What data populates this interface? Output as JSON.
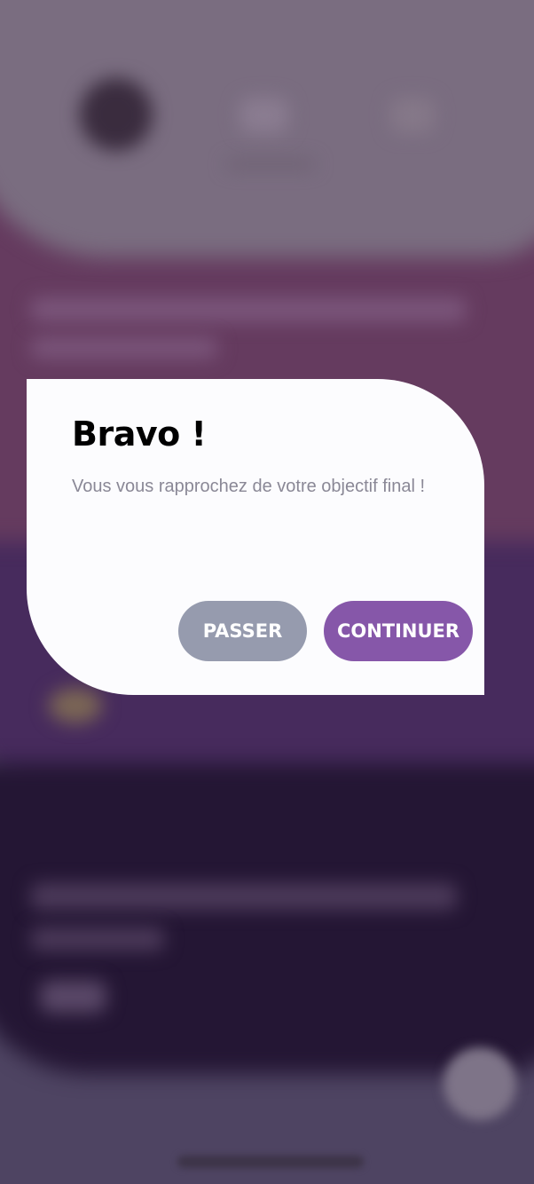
{
  "dialog": {
    "title": "Bravo !",
    "message": "Vous vous rapprochez de votre objectif final !",
    "skip_label": "PASSER",
    "continue_label": "CONTINUER"
  },
  "colors": {
    "dialog_background": "#fcfcfe",
    "skip_button": "#969bae",
    "continue_button": "#8657a9",
    "message_text": "#8a8896",
    "backdrop_pink": "#653b5f",
    "backdrop_purple": "#472b5d",
    "backdrop_dark": "#241634"
  }
}
